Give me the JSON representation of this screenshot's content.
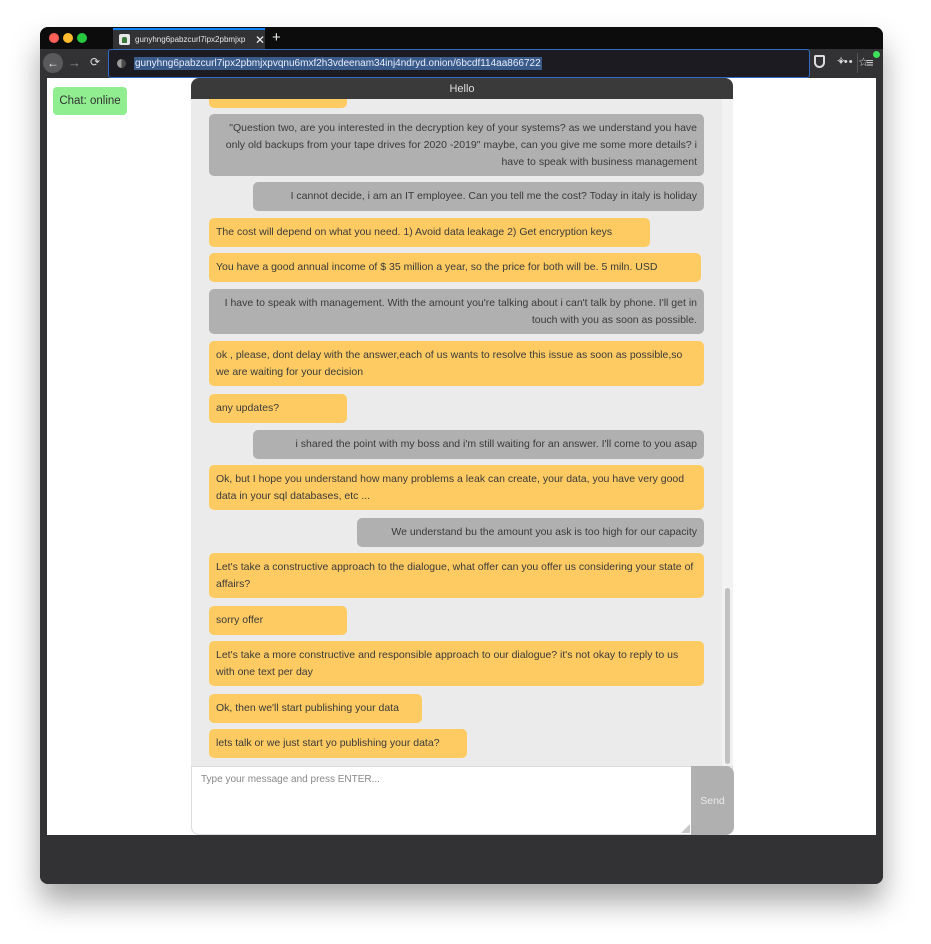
{
  "browser": {
    "tab_title": "gunyhng6pabzcurl7ipx2pbmjxp",
    "url": "gunyhng6pabzcurl7ipx2pbmjxpvqnu6mxf2h3vdeenam34inj4ndryd.onion/6bcdf114aa866722",
    "icons": {
      "back": "arrow-left-icon",
      "forward": "arrow-right-icon",
      "reload": "reload-icon",
      "site_info": "site-info-icon",
      "more": "ellipsis-icon",
      "bookmark": "star-icon",
      "shield": "shield-icon",
      "cleanup": "sweep-icon",
      "menu": "hamburger-menu-icon"
    }
  },
  "status": {
    "label": "Chat: online",
    "color": "#90ee90"
  },
  "chat": {
    "title": "Hello",
    "colors": {
      "them": "#fdcb62",
      "me": "#b0b0b0"
    },
    "messages": [
      {
        "from": "them",
        "text": ""
      },
      {
        "from": "me",
        "text": "\"Question two, are you interested in the decryption key of your systems? as we understand you have only old backups from your tape drives for 2020 -2019\" maybe, can you give me some more details? i have to speak with business management"
      },
      {
        "from": "me",
        "text": "I cannot decide, i am an IT employee. Can you tell me the cost? Today in italy is holiday"
      },
      {
        "from": "them",
        "text": "The cost will depend on what you need. 1) Avoid data leakage 2) Get encryption keys"
      },
      {
        "from": "them",
        "text": "You have a good annual income of $ 35 million a year, so the price for both will be. 5 miln. USD"
      },
      {
        "from": "me",
        "text": "I have to speak with management. With the amount you're talking about i can't talk by phone. I'll get in touch with you as soon as possible."
      },
      {
        "from": "them",
        "text": "ok , please, dont delay with the answer,each of us wants to resolve this issue as soon as possible,so we are waiting for your decision"
      },
      {
        "from": "them",
        "text": "any updates?"
      },
      {
        "from": "me",
        "text": "i shared the point with my boss and i'm still waiting for an answer. I'll come to you asap"
      },
      {
        "from": "them",
        "text": "Ok, but I hope you understand how many problems a leak can create, your data, you have very good data in your sql databases, etc ..."
      },
      {
        "from": "me",
        "text": "We understand bu the amount you ask is too high for our capacity"
      },
      {
        "from": "them",
        "text": "Let's take a constructive approach to the dialogue, what offer can you offer us considering your state of affairs?"
      },
      {
        "from": "them",
        "text": "sorry offer"
      },
      {
        "from": "them",
        "text": "Let's take a more constructive and responsible approach to our dialogue? it's not okay to reply to us with one text per day"
      },
      {
        "from": "them",
        "text": "Ok, then we'll start publishing your data"
      },
      {
        "from": "them",
        "text": "lets talk or we just start yo publishing your data?"
      }
    ]
  },
  "composer": {
    "placeholder": "Type your message and press ENTER...",
    "value": "",
    "send_label": "Send"
  }
}
